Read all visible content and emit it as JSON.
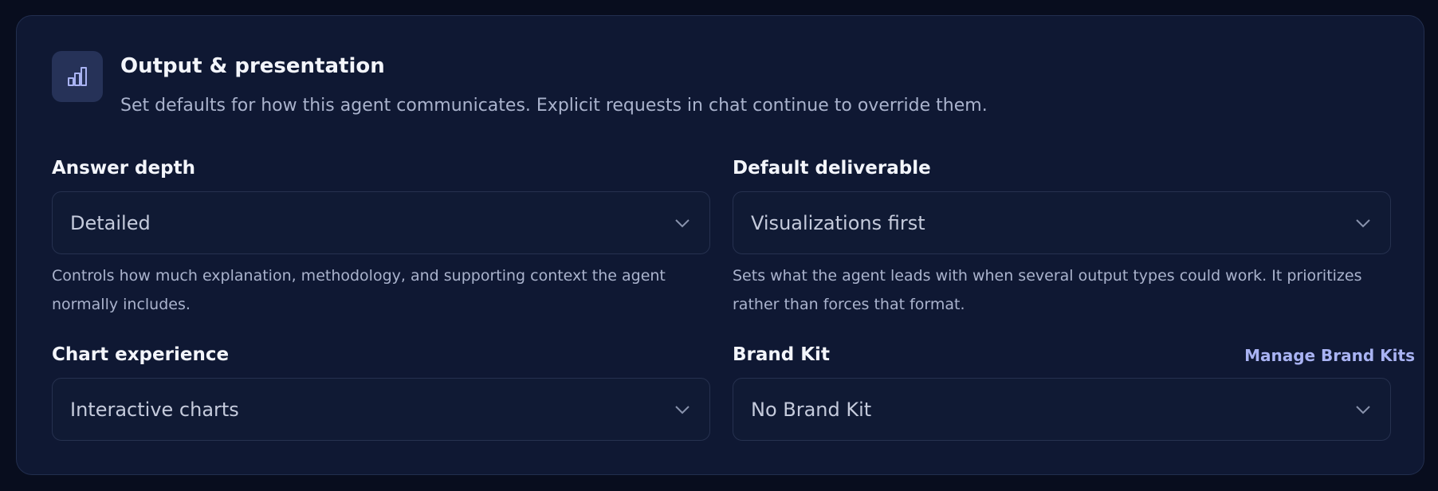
{
  "section": {
    "icon": "bar-chart-icon",
    "title": "Output & presentation",
    "subtitle": "Set defaults for how this agent communicates. Explicit requests in chat continue to override them."
  },
  "fields": {
    "answer_depth": {
      "label": "Answer depth",
      "value": "Detailed",
      "help": "Controls how much explanation, methodology, and supporting context the agent normally includes."
    },
    "default_deliverable": {
      "label": "Default deliverable",
      "value": "Visualizations first",
      "help": "Sets what the agent leads with when several output types could work. It prioritizes rather than forces that format."
    },
    "chart_experience": {
      "label": "Chart experience",
      "value": "Interactive charts"
    },
    "brand_kit": {
      "label": "Brand Kit",
      "value": "No Brand Kit",
      "link": "Manage Brand Kits"
    }
  },
  "colors": {
    "background": "#080d1e",
    "card": "#0f1833",
    "accent_link": "#a9b3f3",
    "icon_tile": "#263258"
  }
}
